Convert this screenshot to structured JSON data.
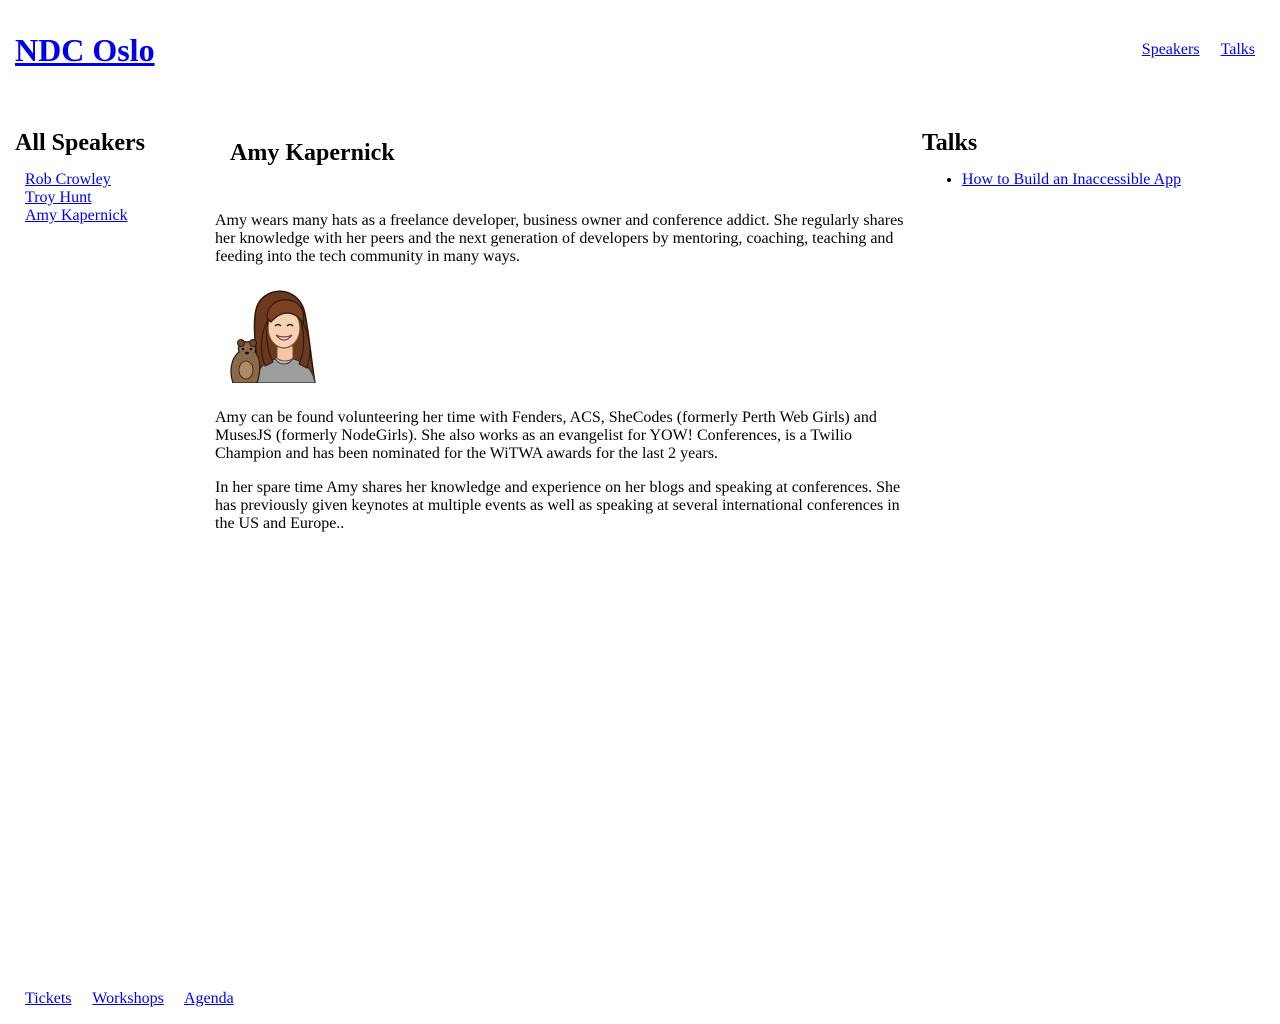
{
  "header": {
    "site_title": "NDC Oslo",
    "nav": [
      "Speakers",
      "Talks"
    ]
  },
  "sidebar": {
    "heading": "All Speakers",
    "speakers": [
      "Rob Crowley",
      "Troy Hunt",
      "Amy Kapernick"
    ]
  },
  "speaker": {
    "name": "Amy Kapernick",
    "bio": [
      "Amy wears many hats as a freelance developer, business owner and conference addict. She regularly shares her knowledge with her peers and the next generation of developers by mentoring, coaching, teaching and feeding into the tech community in many ways.",
      "Amy can be found volunteering her time with Fenders, ACS, SheCodes (formerly Perth Web Girls) and MusesJS (formerly NodeGirls). She also works as an evangelist for YOW! Conferences, is a Twilio Champion and has been nominated for the WiTWA awards for the last 2 years.",
      "In her spare time Amy shares her knowledge and experience on her blogs and speaking at conferences. She has previously given keynotes at multiple events as well as speaking at several international conferences in the US and Europe.."
    ]
  },
  "talks": {
    "heading": "Talks",
    "items": [
      "How to Build an Inaccessible App"
    ]
  },
  "footer": {
    "nav": [
      "Tickets",
      "Workshops",
      "Agenda"
    ]
  },
  "colors": {
    "link": "#0000ee",
    "text": "#000000",
    "background": "#ffffff"
  }
}
